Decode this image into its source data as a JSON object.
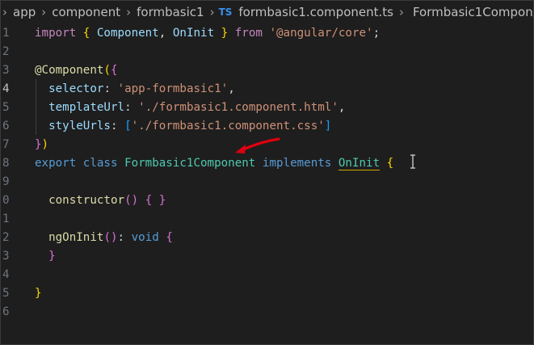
{
  "breadcrumb": {
    "items": [
      "app",
      "component",
      "formbasic1"
    ],
    "file_badge": "TS",
    "file_name": "formbasic1.component.ts",
    "symbol": "Formbasic1Component"
  },
  "editor": {
    "active_line": "4",
    "lines": [
      {
        "num": "1",
        "tokens": [
          [
            "kw",
            "import"
          ],
          [
            "pun",
            " "
          ],
          [
            "brk1",
            "{"
          ],
          [
            "pun",
            " "
          ],
          [
            "prop",
            "Component"
          ],
          [
            "pun",
            ", "
          ],
          [
            "prop",
            "OnInit"
          ],
          [
            "pun",
            " "
          ],
          [
            "brk1",
            "}"
          ],
          [
            "pun",
            " "
          ],
          [
            "kw",
            "from"
          ],
          [
            "pun",
            " "
          ],
          [
            "str",
            "'@angular/core'"
          ],
          [
            "pun",
            ";"
          ]
        ]
      },
      {
        "num": "2",
        "tokens": []
      },
      {
        "num": "3",
        "tokens": [
          [
            "dec",
            "@"
          ],
          [
            "fn",
            "Component"
          ],
          [
            "brk1",
            "("
          ],
          [
            "brk2",
            "{"
          ]
        ]
      },
      {
        "num": "4",
        "tokens": [
          [
            "pun",
            "  "
          ],
          [
            "prop",
            "selector"
          ],
          [
            "pun",
            ": "
          ],
          [
            "str",
            "'app-formbasic1'"
          ],
          [
            "pun",
            ","
          ]
        ]
      },
      {
        "num": "5",
        "tokens": [
          [
            "pun",
            "  "
          ],
          [
            "prop",
            "templateUrl"
          ],
          [
            "pun",
            ": "
          ],
          [
            "str",
            "'./formbasic1.component.html'"
          ],
          [
            "pun",
            ","
          ]
        ]
      },
      {
        "num": "6",
        "tokens": [
          [
            "pun",
            "  "
          ],
          [
            "prop",
            "styleUrls"
          ],
          [
            "pun",
            ": "
          ],
          [
            "brk3",
            "["
          ],
          [
            "str",
            "'./formbasic1.component.css'"
          ],
          [
            "brk3",
            "]"
          ]
        ]
      },
      {
        "num": "7",
        "tokens": [
          [
            "brk2",
            "}"
          ],
          [
            "brk1",
            ")"
          ]
        ]
      },
      {
        "num": "8",
        "tokens": [
          [
            "kw2",
            "export"
          ],
          [
            "pun",
            " "
          ],
          [
            "kw2",
            "class"
          ],
          [
            "pun",
            " "
          ],
          [
            "cls",
            "Formbasic1Component"
          ],
          [
            "pun",
            " "
          ],
          [
            "kw2",
            "implements"
          ],
          [
            "pun",
            " "
          ],
          [
            "ty oninit-under",
            "OnInit"
          ],
          [
            "pun",
            " "
          ],
          [
            "brk1",
            "{"
          ]
        ]
      },
      {
        "num": "9",
        "tokens": []
      },
      {
        "num": "0",
        "tokens": [
          [
            "pun",
            "  "
          ],
          [
            "fn",
            "constructor"
          ],
          [
            "brk2",
            "()"
          ],
          [
            "pun",
            " "
          ],
          [
            "brk2",
            "{"
          ],
          [
            "pun",
            " "
          ],
          [
            "brk2",
            "}"
          ]
        ]
      },
      {
        "num": "1",
        "tokens": []
      },
      {
        "num": "2",
        "tokens": [
          [
            "pun",
            "  "
          ],
          [
            "fn",
            "ngOnInit"
          ],
          [
            "brk2",
            "()"
          ],
          [
            "pun",
            ": "
          ],
          [
            "kw2",
            "void"
          ],
          [
            "pun",
            " "
          ],
          [
            "brk2",
            "{"
          ]
        ]
      },
      {
        "num": "3",
        "tokens": [
          [
            "pun",
            "  "
          ],
          [
            "brk2",
            "}"
          ]
        ]
      },
      {
        "num": "4",
        "tokens": []
      },
      {
        "num": "5",
        "tokens": [
          [
            "brk1",
            "}"
          ]
        ]
      },
      {
        "num": "6",
        "tokens": []
      }
    ]
  },
  "colors": {
    "background": "#1e1e1e",
    "keyword_control": "#c586c0",
    "keyword": "#569cd6",
    "function": "#dcdcaa",
    "class": "#4ec9b0",
    "property": "#9cdcfe",
    "string": "#ce9178",
    "annotation_arrow": "#e0000f"
  },
  "icons": {
    "breadcrumb_separator": "chevron-right-icon",
    "symbol": "class-symbol-icon",
    "annotation": "red-arrow-annotation",
    "cursor": "text-cursor-icon"
  }
}
